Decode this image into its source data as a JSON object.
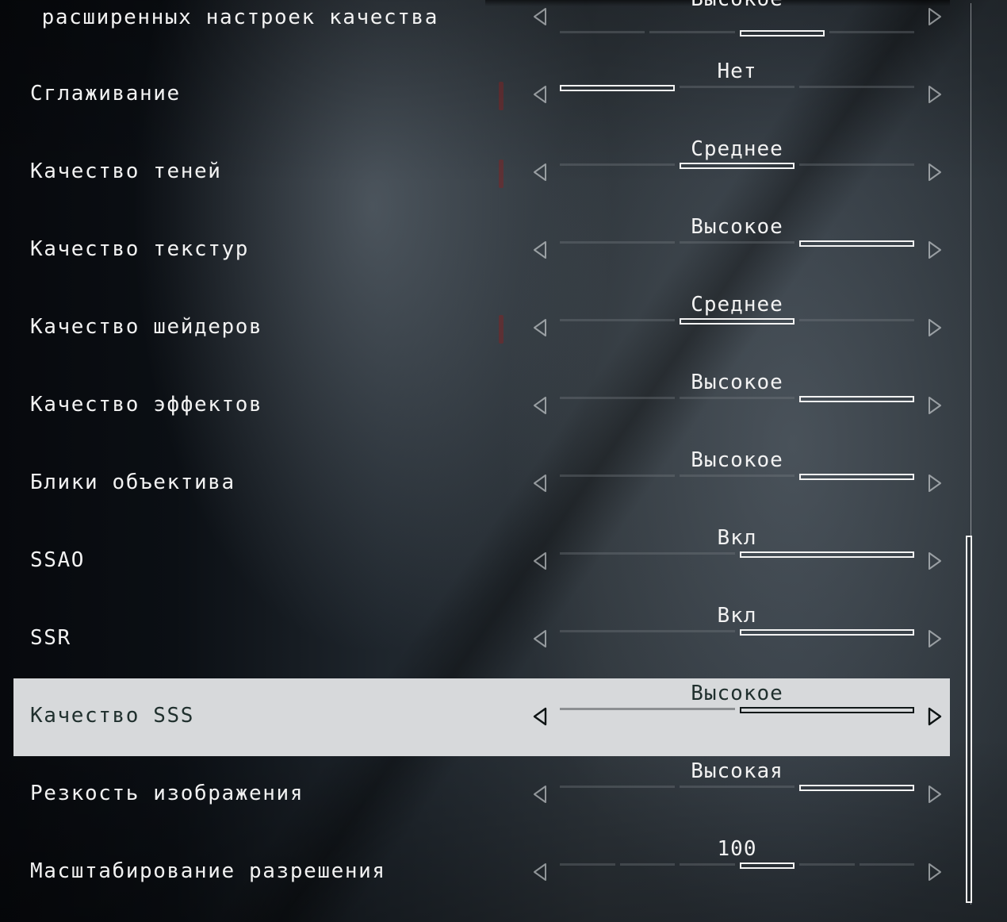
{
  "settings": {
    "rows": [
      {
        "label": "Шаблон расширенных настроек качества",
        "value": "Высокое",
        "segments": 4,
        "active": [
          2,
          3
        ],
        "warn": false,
        "focused": false
      },
      {
        "label": "Сглаживание",
        "value": "Нет",
        "segments": 3,
        "active": [
          0,
          1
        ],
        "warn": true,
        "focused": false
      },
      {
        "label": "Качество теней",
        "value": "Среднее",
        "segments": 3,
        "active": [
          1,
          2
        ],
        "warn": true,
        "focused": false
      },
      {
        "label": "Качество текстур",
        "value": "Высокое",
        "segments": 3,
        "active": [
          2,
          3
        ],
        "warn": false,
        "focused": false
      },
      {
        "label": "Качество шейдеров",
        "value": "Среднее",
        "segments": 3,
        "active": [
          1,
          2
        ],
        "warn": true,
        "focused": false
      },
      {
        "label": "Качество эффектов",
        "value": "Высокое",
        "segments": 3,
        "active": [
          2,
          3
        ],
        "warn": false,
        "focused": false
      },
      {
        "label": "Блики объектива",
        "value": "Высокое",
        "segments": 3,
        "active": [
          2,
          3
        ],
        "warn": false,
        "focused": false
      },
      {
        "label": "SSAO",
        "value": "Вкл",
        "segments": 2,
        "active": [
          1,
          2
        ],
        "warn": false,
        "focused": false
      },
      {
        "label": "SSR",
        "value": "Вкл",
        "segments": 2,
        "active": [
          1,
          2
        ],
        "warn": false,
        "focused": false
      },
      {
        "label": "Качество SSS",
        "value": "Высокое",
        "segments": 2,
        "active": [
          1,
          2
        ],
        "warn": false,
        "focused": true
      },
      {
        "label": "Резкость изображения",
        "value": "Высокая",
        "segments": 3,
        "active": [
          2,
          3
        ],
        "warn": false,
        "focused": false
      },
      {
        "label": "Масштабирование разрешения",
        "value": "100",
        "segments": 6,
        "active": [
          3,
          4
        ],
        "warn": false,
        "focused": false
      }
    ]
  },
  "icons": {
    "prev": "triangle-left-icon",
    "next": "triangle-right-icon"
  },
  "colors": {
    "highlight_bg": "#d7d9db",
    "highlight_text": "#20302e",
    "text": "#f2f2f2",
    "warning": "#8c1e1e"
  }
}
